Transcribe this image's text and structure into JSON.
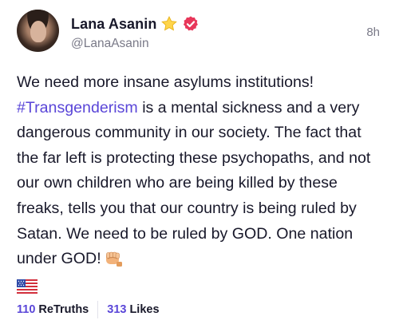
{
  "author": {
    "display_name": "Lana Asanin",
    "handle": "@LanaAsanin",
    "badges": [
      "star-icon",
      "verified-icon"
    ]
  },
  "post": {
    "time": "8h",
    "text_before_hashtag": "We need more insane asylums institutions! ",
    "hashtag": "#Transgenderism",
    "text_after_hashtag": " is a mental sickness and a very dangerous community in our society. The fact that the far left is protecting these psychopaths, and not our own children who are being killed by these freaks, tells you that our country is being ruled by Satan. We need to be ruled by GOD. One nation under GOD!",
    "emojis": [
      "fist-icon",
      "us-flag-icon"
    ]
  },
  "stats": {
    "retruths_count": "110",
    "retruths_label": "ReTruths",
    "likes_count": "313",
    "likes_label": "Likes"
  },
  "colors": {
    "accent": "#5a46d8",
    "verified": "#e8375a",
    "text": "#18182a",
    "muted": "#7a7a88"
  }
}
